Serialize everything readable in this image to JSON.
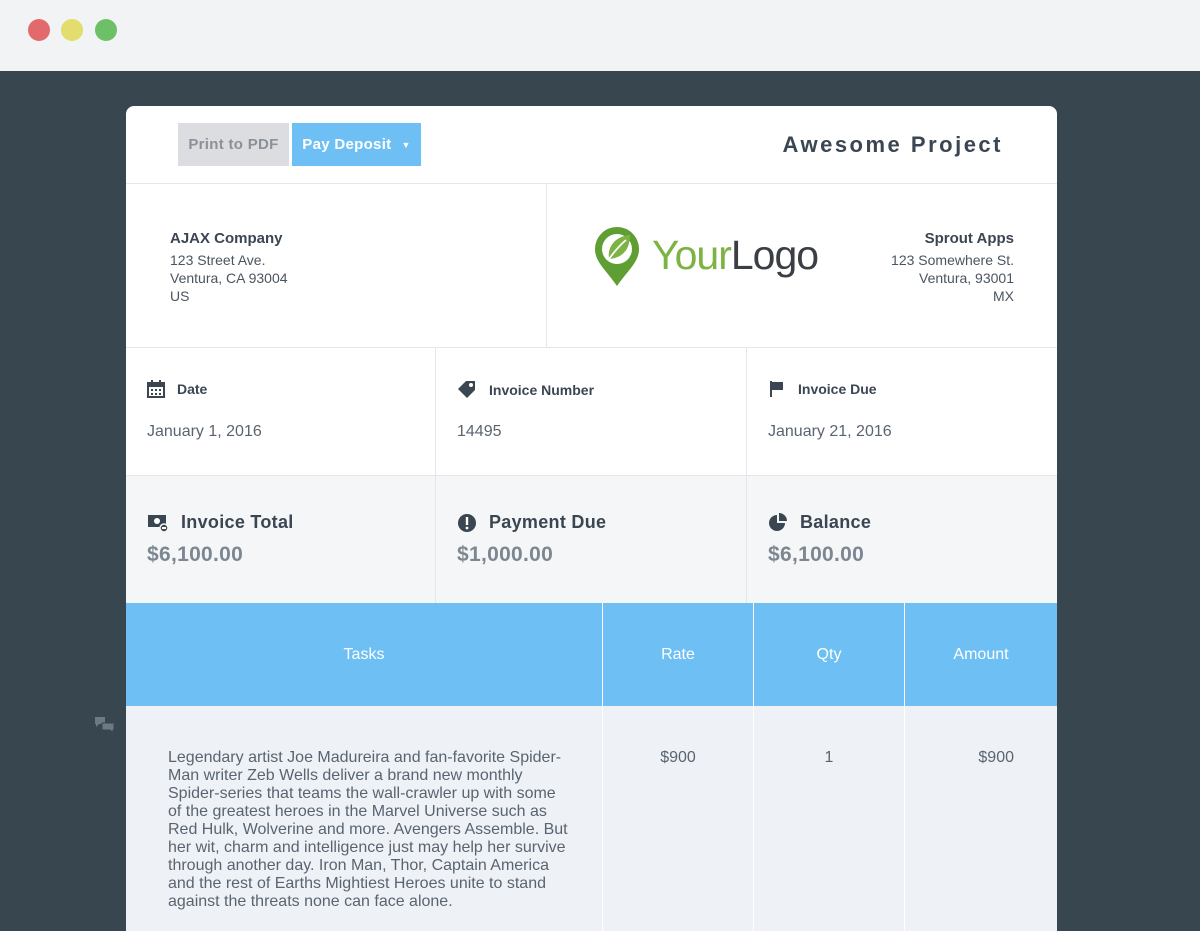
{
  "window": {
    "buttons": [
      "close",
      "minimize",
      "maximize"
    ],
    "colors": {
      "close": "#e36a6c",
      "minimize": "#e2dd6d",
      "maximize": "#6ec067"
    }
  },
  "toolbar": {
    "print_label": "Print to PDF",
    "pay_label": "Pay Deposit",
    "project_title": "Awesome Project"
  },
  "from": {
    "name": "AJAX Company",
    "street": "123 Street Ave.",
    "city": "Ventura, CA 93004",
    "country": "US"
  },
  "logo": {
    "word1": "Your",
    "word2": "Logo"
  },
  "to": {
    "name": "Sprout Apps",
    "street": "123 Somewhere St.",
    "city": "Ventura, 93001",
    "country": "MX"
  },
  "meta": {
    "date_label": "Date",
    "date_value": "January 1, 2016",
    "number_label": "Invoice Number",
    "number_value": "14495",
    "due_label": "Invoice Due",
    "due_value": "January 21, 2016"
  },
  "totals": {
    "total_label": "Invoice Total",
    "total_value": "$6,100.00",
    "payment_label": "Payment Due",
    "payment_value": "$1,000.00",
    "balance_label": "Balance",
    "balance_value": "$6,100.00"
  },
  "table": {
    "headers": {
      "tasks": "Tasks",
      "rate": "Rate",
      "qty": "Qty",
      "amount": "Amount"
    },
    "rows": [
      {
        "description": "Legendary artist Joe Madureira and fan-favorite Spider-Man writer Zeb Wells deliver a brand new monthly Spider-series that teams the wall-crawler up with some of the greatest heroes in the Marvel Universe such as Red Hulk, Wolverine and more. Avengers Assemble. But her wit, charm and intelligence just may help her survive through another day. Iron Man, Thor, Captain America and the rest of Earths Mightiest Heroes unite to stand against the threats none can face alone.",
        "rate": "$900",
        "qty": "1",
        "amount": "$900"
      }
    ]
  },
  "colors": {
    "accent": "#6ebff4",
    "logo_green": "#7cb342",
    "page_bg": "#38464f"
  },
  "icons": [
    "calendar-icon",
    "tag-icon",
    "flag-icon",
    "invoice-icon",
    "exclamation-icon",
    "pie-chart-icon",
    "comment-icon",
    "leaf-pin-icon"
  ]
}
